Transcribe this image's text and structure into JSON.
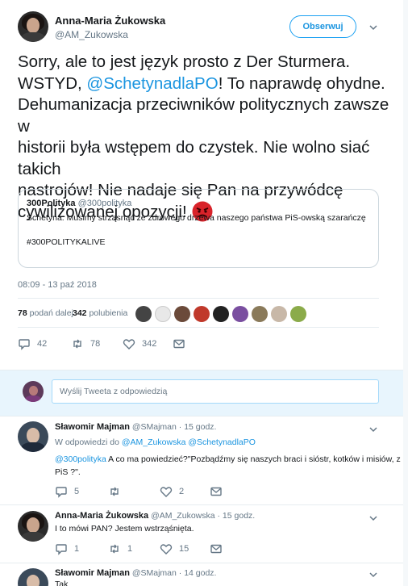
{
  "tweet": {
    "author_name": "Anna-Maria Żukowska",
    "author_handle": "@AM_Zukowska",
    "follow_label": "Obserwuj",
    "text_line1": "Sorry, ale to jest język prosto z Der Sturmera.",
    "text_line2_prefix": "WSTYD, ",
    "text_line2_mention": "@SchetynadlaPO",
    "text_line2_suffix": "! To naprawdę ohydne.",
    "text_line3": "Dehumanizacja przeciwników politycznych zawsze w",
    "text_line4": "historii była wstępem do czystek. Nie wolno siać takich",
    "text_line5": "nastrojów! Nie nadaje się Pan na przywódcę",
    "text_line6": "cywilizowanej opozycji!",
    "emoji_name": "angry-face-emoji",
    "timestamp": "08:09 - 13 paź 2018",
    "retweets_count": "78",
    "retweets_label": "podań dalej",
    "likes_count": "342",
    "likes_label": "polubienia",
    "action_reply": "42",
    "action_retweet": "78",
    "action_like": "342"
  },
  "quote": {
    "author_name": "300Polityka",
    "author_handle": "@300polityka",
    "text": "Schetyna: Musimy strząsnąć ze zdrowego drzewa naszego państwa PiS-owską szarańczę",
    "hashtag": "#300POLITYKALIVE"
  },
  "compose": {
    "placeholder": "Wyślij Tweeta z odpowiedzią"
  },
  "replies": [
    {
      "author_name": "Sławomir Majman",
      "author_handle": "@SMajman",
      "time": "· 15 godz.",
      "replying_prefix": "W odpowiedzi do ",
      "replying_to": "@AM_Zukowska @SchetynadlaPO",
      "text_mention": "@300polityka",
      "text_line1": " A co ma powiedzieć?\"Pozbądźmy się naszych braci i sióstr, kotków i misiów, z",
      "text_line2": "PiS ?\".",
      "replies": "5",
      "retweets": "",
      "likes": "2"
    },
    {
      "author_name": "Anna-Maria Żukowska",
      "author_handle": "@AM_Zukowska",
      "time": "· 15 godz.",
      "text_line1": "I to mówi PAN? Jestem wstrząśnięta.",
      "replies": "1",
      "retweets": "1",
      "likes": "15"
    },
    {
      "author_name": "Sławomir Majman",
      "author_handle": "@SMajman",
      "time": "· 14 godz.",
      "text_line1": "Tak"
    }
  ],
  "colors": {
    "accent": "#1da1f2",
    "link": "#1b95e0",
    "muted": "#657786",
    "divider": "#e6ecf0",
    "reply_bg": "#ffffff"
  }
}
